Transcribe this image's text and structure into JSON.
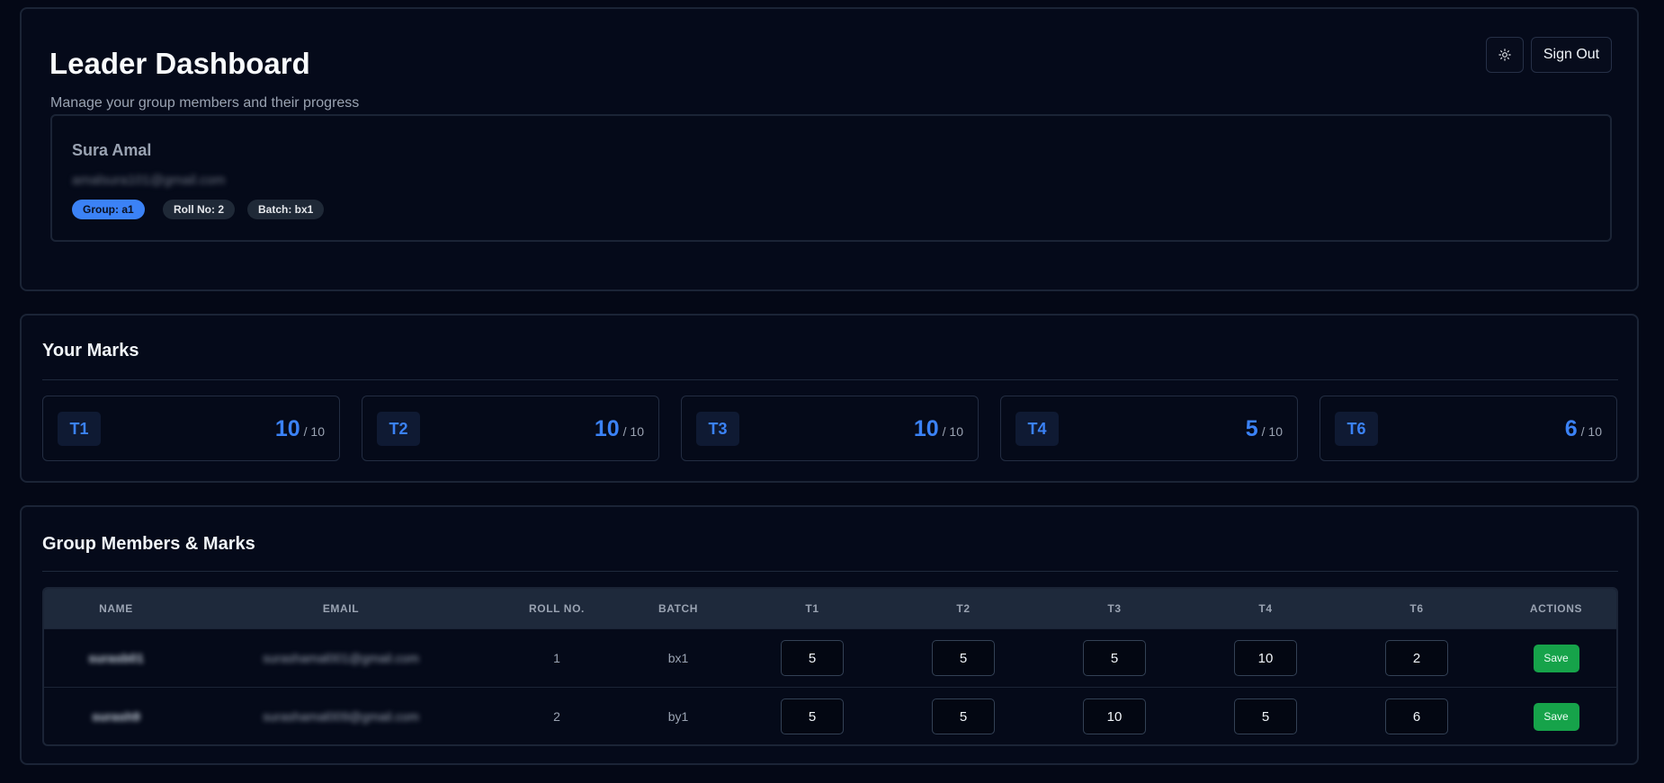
{
  "header": {
    "title": "Leader Dashboard",
    "subtitle": "Manage your group members and their progress",
    "theme_toggle_icon": "sun-icon",
    "sign_out_label": "Sign Out"
  },
  "profile": {
    "name": "Sura Amal",
    "email": "amalsura101@gmail.com",
    "group_badge": "Group: a1",
    "roll_badge": "Roll No: 2",
    "batch_badge": "Batch: bx1"
  },
  "your_marks": {
    "title": "Your Marks",
    "items": [
      {
        "label": "T1",
        "score": "10",
        "max": "/ 10"
      },
      {
        "label": "T2",
        "score": "10",
        "max": "/ 10"
      },
      {
        "label": "T3",
        "score": "10",
        "max": "/ 10"
      },
      {
        "label": "T4",
        "score": "5",
        "max": "/ 10"
      },
      {
        "label": "T6",
        "score": "6",
        "max": "/ 10"
      }
    ]
  },
  "group": {
    "title": "Group Members & Marks",
    "columns": [
      "NAME",
      "EMAIL",
      "ROLL NO.",
      "BATCH",
      "T1",
      "T2",
      "T3",
      "T4",
      "T6",
      "ACTIONS"
    ],
    "save_label": "Save",
    "rows": [
      {
        "name": "surasb01",
        "email": "surashamal001@gmail.com",
        "roll": "1",
        "batch": "bx1",
        "t1": "5",
        "t2": "5",
        "t3": "5",
        "t4": "10",
        "t6": "2"
      },
      {
        "name": "surash9",
        "email": "surashamal009@gmail.com",
        "roll": "2",
        "batch": "by1",
        "t1": "5",
        "t2": "5",
        "t3": "10",
        "t4": "5",
        "t6": "6"
      }
    ]
  },
  "colors": {
    "accent": "#3b82f6",
    "save": "#16a34a",
    "background": "#040816"
  }
}
